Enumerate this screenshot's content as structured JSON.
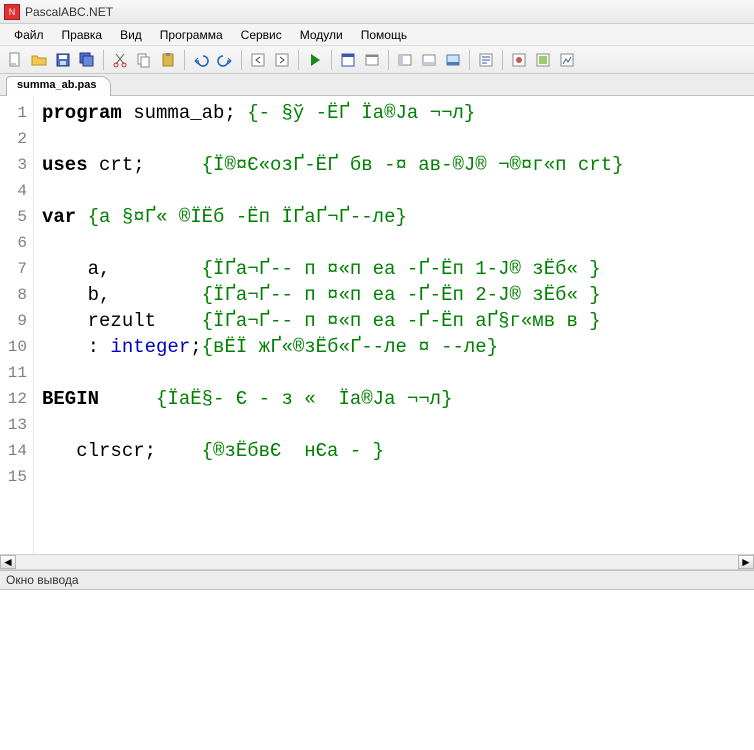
{
  "window": {
    "title": "PascalABC.NET"
  },
  "menu": {
    "items": [
      "Файл",
      "Правка",
      "Вид",
      "Программа",
      "Сервис",
      "Модули",
      "Помощь"
    ]
  },
  "toolbar_icons": [
    "new-file-icon",
    "open-file-icon",
    "save-icon",
    "save-all-icon",
    "sep",
    "cut-icon",
    "copy-icon",
    "paste-icon",
    "sep",
    "undo-icon",
    "redo-icon",
    "sep",
    "nav-back-icon",
    "nav-forward-icon",
    "sep",
    "run-icon",
    "sep",
    "form-icon",
    "window-icon",
    "sep",
    "panel1-icon",
    "panel2-icon",
    "panel3-icon",
    "sep",
    "code-template-icon",
    "sep",
    "view1-icon",
    "view2-icon",
    "view3-icon"
  ],
  "tab": {
    "label": "summa_ab.pas"
  },
  "code": {
    "lines": [
      {
        "n": "1",
        "seg": [
          {
            "c": "kw",
            "t": "program"
          },
          {
            "c": "",
            "t": " summa_ab; "
          },
          {
            "c": "cm",
            "t": "{- §ў -ЁҐ Їа®Ја ¬¬л}"
          }
        ]
      },
      {
        "n": "2",
        "seg": []
      },
      {
        "n": "3",
        "seg": [
          {
            "c": "kw",
            "t": "uses"
          },
          {
            "c": "",
            "t": " crt;     "
          },
          {
            "c": "cm",
            "t": "{Ї®¤Є«озҐ-ЁҐ бв -¤ ав-®Ј® ¬®¤г«п crt}"
          }
        ]
      },
      {
        "n": "4",
        "seg": []
      },
      {
        "n": "5",
        "seg": [
          {
            "c": "kw",
            "t": "var"
          },
          {
            "c": "",
            "t": " "
          },
          {
            "c": "cm",
            "t": "{а §¤Ґ« ®ЇЁб -Ёп ЇҐаҐ¬Ґ--ле}"
          }
        ]
      },
      {
        "n": "6",
        "seg": []
      },
      {
        "n": "7",
        "seg": [
          {
            "c": "",
            "t": "    a,        "
          },
          {
            "c": "cm",
            "t": "{ЇҐа¬Ґ-- п ¤«п еа -Ґ-Ёп 1-Ј® зЁб« }"
          }
        ]
      },
      {
        "n": "8",
        "seg": [
          {
            "c": "",
            "t": "    b,        "
          },
          {
            "c": "cm",
            "t": "{ЇҐа¬Ґ-- п ¤«п еа -Ґ-Ёп 2-Ј® зЁб« }"
          }
        ]
      },
      {
        "n": "9",
        "seg": [
          {
            "c": "",
            "t": "    rezult    "
          },
          {
            "c": "cm",
            "t": "{ЇҐа¬Ґ-- п ¤«п еа -Ґ-Ёп аҐ§г«мв в }"
          }
        ]
      },
      {
        "n": "10",
        "seg": [
          {
            "c": "",
            "t": "    : "
          },
          {
            "c": "ty",
            "t": "integer"
          },
          {
            "c": "",
            "t": ";"
          },
          {
            "c": "cm",
            "t": "{вЁЇ жҐ«®зЁб«Ґ--ле ¤ --ле}"
          }
        ]
      },
      {
        "n": "11",
        "seg": []
      },
      {
        "n": "12",
        "seg": [
          {
            "c": "kw",
            "t": "BEGIN"
          },
          {
            "c": "",
            "t": "     "
          },
          {
            "c": "cm",
            "t": "{ЇаЁ§- Є - з «  Їа®Ја ¬¬л}"
          }
        ]
      },
      {
        "n": "13",
        "seg": []
      },
      {
        "n": "14",
        "seg": [
          {
            "c": "",
            "t": "   clrscr;    "
          },
          {
            "c": "cm",
            "t": "{®зЁбвЄ  нЄа - }"
          }
        ]
      },
      {
        "n": "15",
        "seg": []
      }
    ]
  },
  "output_panel": {
    "title": "Окно вывода"
  }
}
